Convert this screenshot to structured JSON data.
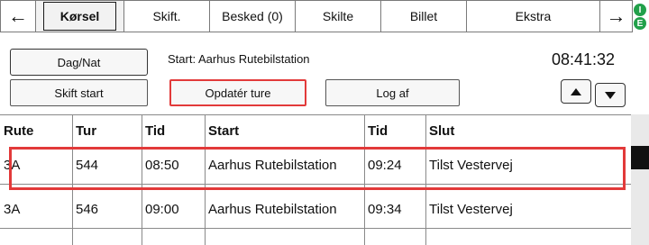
{
  "nav": {
    "back_arrow": "←",
    "forward_arrow": "→",
    "tabs": [
      "Kørsel",
      "Skift.",
      "Besked (0)",
      "Skilte",
      "Billet",
      "Ekstra"
    ],
    "active_tab": "Kørsel"
  },
  "status_indicator": {
    "letters": [
      "I",
      "E"
    ],
    "color": "#22a04a"
  },
  "controls": {
    "day_night": "Dag/Nat",
    "start_label": "Start: Aarhus Rutebilstation",
    "clock": "08:41:32",
    "shift_start": "Skift start",
    "update_trips": "Opdatér ture",
    "log_off": "Log af"
  },
  "table": {
    "headers": [
      "Rute",
      "Tur",
      "Tid",
      "Start",
      "Tid",
      "Slut"
    ],
    "rows": [
      [
        "3A",
        "544",
        "08:50",
        "Aarhus Rutebilstation",
        "09:24",
        "Tilst Vestervej"
      ],
      [
        "3A",
        "546",
        "09:00",
        "Aarhus Rutebilstation",
        "09:34",
        "Tilst Vestervej"
      ],
      [
        "",
        "",
        "",
        "",
        "",
        ""
      ]
    ]
  },
  "colors": {
    "highlight": "#e23a3a",
    "accent_green": "#22a04a"
  }
}
